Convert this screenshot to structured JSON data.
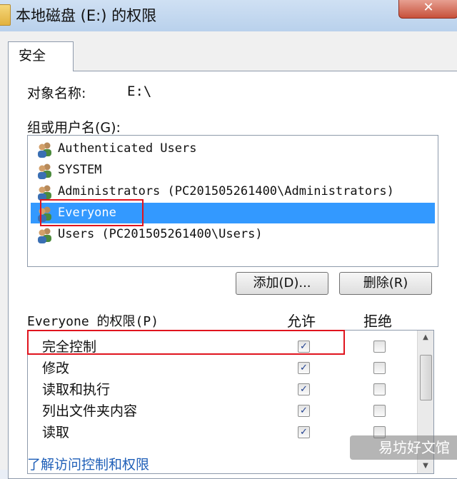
{
  "window": {
    "title": "本地磁盘 (E:) 的权限",
    "close_label": "✕"
  },
  "tab": {
    "label": "安全"
  },
  "object": {
    "label": "对象名称:",
    "value": "E:\\"
  },
  "group_label": "组或用户名(G):",
  "users": [
    {
      "name": "Authenticated Users",
      "selected": false
    },
    {
      "name": "SYSTEM",
      "selected": false
    },
    {
      "name": "Administrators (PC201505261400\\Administrators)",
      "selected": false
    },
    {
      "name": "Everyone",
      "selected": true
    },
    {
      "name": "Users (PC201505261400\\Users)",
      "selected": false
    }
  ],
  "buttons": {
    "add": "添加(D)...",
    "remove": "删除(R)"
  },
  "permissions": {
    "title": "Everyone 的权限(P)",
    "allow_header": "允许",
    "deny_header": "拒绝",
    "rows": [
      {
        "name": "完全控制",
        "allow": true,
        "deny": false
      },
      {
        "name": "修改",
        "allow": true,
        "deny": false
      },
      {
        "name": "读取和执行",
        "allow": true,
        "deny": false
      },
      {
        "name": "列出文件夹内容",
        "allow": true,
        "deny": false
      },
      {
        "name": "读取",
        "allow": true,
        "deny": false
      }
    ]
  },
  "link": "了解访问控制和权限",
  "watermark": "易坊好文馆",
  "colors": {
    "selection": "#3399ff",
    "highlight": "#e0141e",
    "link": "#1f5fb8"
  }
}
